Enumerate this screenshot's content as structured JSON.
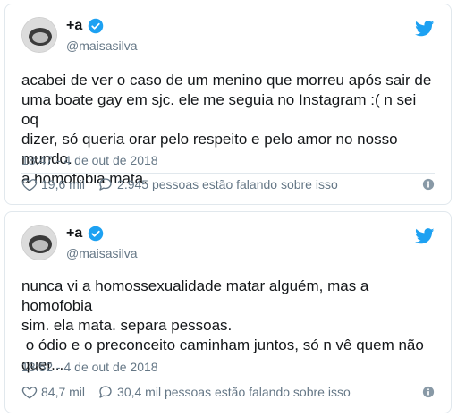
{
  "tweets": [
    {
      "name": "+a",
      "handle": "@maisasilva",
      "text": "acabei de ver o caso de um menino que morreu após sair de\numa boate gay em sjc. ele me seguia no Instagram :( n sei oq\ndizer, só queria orar pelo respeito e pelo amor no nosso mundo.\na homofobia mata.",
      "timestamp": "18:47 - 4 de out de 2018",
      "likes": "19,6 mil",
      "replies": "2.945 pessoas estão falando sobre isso"
    },
    {
      "name": "+a",
      "handle": "@maisasilva",
      "text": "nunca vi a homossexualidade matar alguém, mas a  homofobia\nsim. ela mata. separa pessoas.\n o ódio e o preconceito caminham juntos, só n vê quem não\nquer...",
      "timestamp": "18:52 - 4 de out de 2018",
      "likes": "84,7 mil",
      "replies": "30,4 mil pessoas estão falando sobre isso"
    }
  ],
  "colors": {
    "twitter_blue": "#1da1f2",
    "text": "#14171a",
    "muted": "#657786",
    "border": "#e1e8ed"
  },
  "icons": [
    "avatar",
    "verified-badge-icon",
    "twitter-bird-icon",
    "heart-icon",
    "reply-bubble-icon",
    "info-icon"
  ]
}
